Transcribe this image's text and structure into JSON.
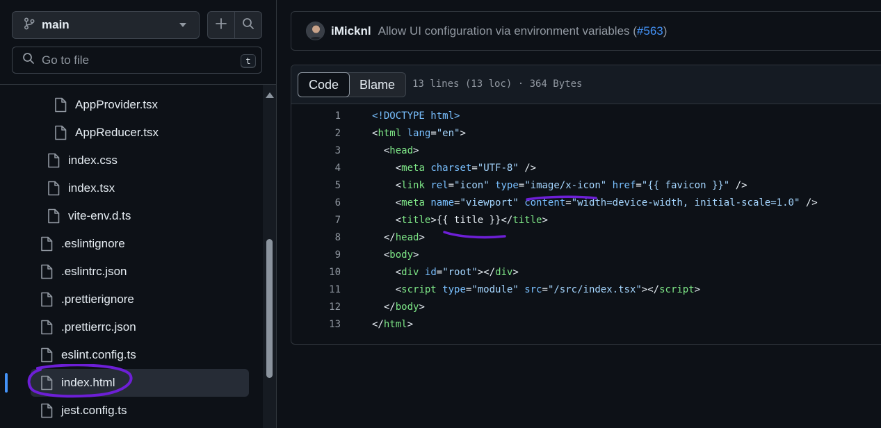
{
  "sidebar": {
    "branch": "main",
    "search_placeholder": "Go to file",
    "search_shortcut": "t",
    "items": [
      {
        "label": "AppProvider.tsx"
      },
      {
        "label": "AppReducer.tsx"
      },
      {
        "label": "index.css"
      },
      {
        "label": "index.tsx"
      },
      {
        "label": "vite-env.d.ts"
      },
      {
        "label": ".eslintignore"
      },
      {
        "label": ".eslintrc.json"
      },
      {
        "label": ".prettierignore"
      },
      {
        "label": ".prettierrc.json"
      },
      {
        "label": "eslint.config.ts"
      },
      {
        "label": "index.html"
      },
      {
        "label": "jest.config.ts"
      }
    ],
    "selected_item": "index.html"
  },
  "commit": {
    "author": "iMicknl",
    "message": "Allow UI configuration via environment variables (",
    "pr_link": "#563",
    "message_end": ")"
  },
  "viewer": {
    "tabs": [
      {
        "label": "Code"
      },
      {
        "label": "Blame"
      }
    ],
    "active_tab": "Code",
    "file_info": "13 lines (13 loc) · 364 Bytes"
  },
  "code": {
    "lines": [
      {
        "n": "1",
        "tokens": [
          [
            "doc",
            "<!DOCTYPE html>"
          ]
        ]
      },
      {
        "n": "2",
        "tokens": [
          [
            "txt",
            "<"
          ],
          [
            "tag",
            "html"
          ],
          [
            "txt",
            " "
          ],
          [
            "attr",
            "lang"
          ],
          [
            "txt",
            "="
          ],
          [
            "str",
            "\"en\""
          ],
          [
            "txt",
            ">"
          ]
        ]
      },
      {
        "n": "3",
        "tokens": [
          [
            "txt",
            "  <"
          ],
          [
            "tag",
            "head"
          ],
          [
            "txt",
            ">"
          ]
        ]
      },
      {
        "n": "4",
        "tokens": [
          [
            "txt",
            "    <"
          ],
          [
            "tag",
            "meta"
          ],
          [
            "txt",
            " "
          ],
          [
            "attr",
            "charset"
          ],
          [
            "txt",
            "="
          ],
          [
            "str",
            "\"UTF-8\""
          ],
          [
            "txt",
            " />"
          ]
        ]
      },
      {
        "n": "5",
        "tokens": [
          [
            "txt",
            "    <"
          ],
          [
            "tag",
            "link"
          ],
          [
            "txt",
            " "
          ],
          [
            "attr",
            "rel"
          ],
          [
            "txt",
            "="
          ],
          [
            "str",
            "\"icon\""
          ],
          [
            "txt",
            " "
          ],
          [
            "attr",
            "type"
          ],
          [
            "txt",
            "="
          ],
          [
            "str",
            "\"image/x-icon\""
          ],
          [
            "txt",
            " "
          ],
          [
            "attr",
            "href"
          ],
          [
            "txt",
            "="
          ],
          [
            "str",
            "\"{{ favicon }}\""
          ],
          [
            "txt",
            " />"
          ]
        ]
      },
      {
        "n": "6",
        "tokens": [
          [
            "txt",
            "    <"
          ],
          [
            "tag",
            "meta"
          ],
          [
            "txt",
            " "
          ],
          [
            "attr",
            "name"
          ],
          [
            "txt",
            "="
          ],
          [
            "str",
            "\"viewport\""
          ],
          [
            "txt",
            " "
          ],
          [
            "attr",
            "content"
          ],
          [
            "txt",
            "="
          ],
          [
            "str",
            "\"width=device-width, initial-scale=1.0\""
          ],
          [
            "txt",
            " />"
          ]
        ]
      },
      {
        "n": "7",
        "tokens": [
          [
            "txt",
            "    <"
          ],
          [
            "tag",
            "title"
          ],
          [
            "txt",
            ">{{ title }}</"
          ],
          [
            "tag",
            "title"
          ],
          [
            "txt",
            ">"
          ]
        ]
      },
      {
        "n": "8",
        "tokens": [
          [
            "txt",
            "  </"
          ],
          [
            "tag",
            "head"
          ],
          [
            "txt",
            ">"
          ]
        ]
      },
      {
        "n": "9",
        "tokens": [
          [
            "txt",
            "  <"
          ],
          [
            "tag",
            "body"
          ],
          [
            "txt",
            ">"
          ]
        ]
      },
      {
        "n": "10",
        "tokens": [
          [
            "txt",
            "    <"
          ],
          [
            "tag",
            "div"
          ],
          [
            "txt",
            " "
          ],
          [
            "attr",
            "id"
          ],
          [
            "txt",
            "="
          ],
          [
            "str",
            "\"root\""
          ],
          [
            "txt",
            "></"
          ],
          [
            "tag",
            "div"
          ],
          [
            "txt",
            ">"
          ]
        ]
      },
      {
        "n": "11",
        "tokens": [
          [
            "txt",
            "    <"
          ],
          [
            "tag",
            "script"
          ],
          [
            "txt",
            " "
          ],
          [
            "attr",
            "type"
          ],
          [
            "txt",
            "="
          ],
          [
            "str",
            "\"module\""
          ],
          [
            "txt",
            " "
          ],
          [
            "attr",
            "src"
          ],
          [
            "txt",
            "="
          ],
          [
            "str",
            "\"/src/index.tsx\""
          ],
          [
            "txt",
            "></"
          ],
          [
            "tag",
            "script"
          ],
          [
            "txt",
            ">"
          ]
        ]
      },
      {
        "n": "12",
        "tokens": [
          [
            "txt",
            "  </"
          ],
          [
            "tag",
            "body"
          ],
          [
            "txt",
            ">"
          ]
        ]
      },
      {
        "n": "13",
        "tokens": [
          [
            "txt",
            "</"
          ],
          [
            "tag",
            "html"
          ],
          [
            "txt",
            ">"
          ]
        ]
      }
    ]
  },
  "colors": {
    "annotation": "#6d1fd6",
    "accent": "#4493f8"
  }
}
